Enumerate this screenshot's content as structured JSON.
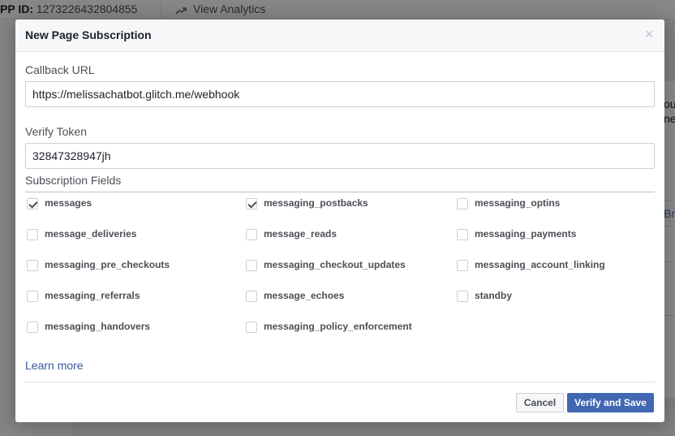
{
  "background": {
    "app_id_label": "PP ID:",
    "app_id_value": "1273226432804855",
    "view_analytics": "View Analytics",
    "right_fragment_1": "ou",
    "right_fragment_2": "ne",
    "right_fragment_3": "Bn"
  },
  "modal": {
    "title": "New Page Subscription",
    "close_glyph": "×",
    "callback_url": {
      "label": "Callback URL",
      "value": "https://melissachatbot.glitch.me/webhook"
    },
    "verify_token": {
      "label": "Verify Token",
      "value": "32847328947jh"
    },
    "subscription_fields": {
      "label": "Subscription Fields",
      "items": [
        {
          "label": "messages",
          "checked": true
        },
        {
          "label": "messaging_postbacks",
          "checked": true
        },
        {
          "label": "messaging_optins",
          "checked": false
        },
        {
          "label": "message_deliveries",
          "checked": false
        },
        {
          "label": "message_reads",
          "checked": false
        },
        {
          "label": "messaging_payments",
          "checked": false
        },
        {
          "label": "messaging_pre_checkouts",
          "checked": false
        },
        {
          "label": "messaging_checkout_updates",
          "checked": false
        },
        {
          "label": "messaging_account_linking",
          "checked": false
        },
        {
          "label": "messaging_referrals",
          "checked": false
        },
        {
          "label": "message_echoes",
          "checked": false
        },
        {
          "label": "standby",
          "checked": false
        },
        {
          "label": "messaging_handovers",
          "checked": false
        },
        {
          "label": "messaging_policy_enforcement",
          "checked": false
        }
      ]
    },
    "learn_more": "Learn more",
    "cancel_label": "Cancel",
    "verify_save_label": "Verify and Save"
  }
}
